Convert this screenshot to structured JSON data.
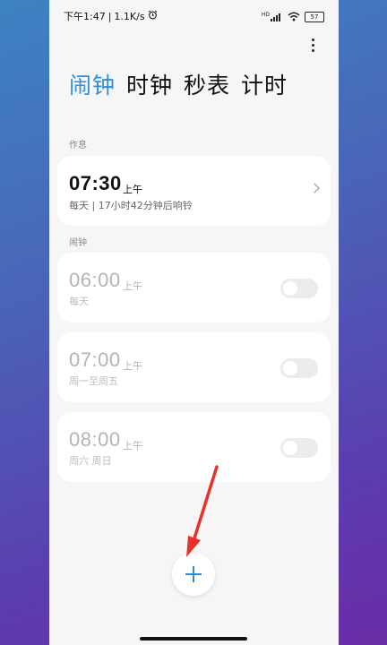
{
  "status_bar": {
    "time": "下午1:47",
    "separator": "|",
    "speed": "1.1K/s",
    "battery": "57",
    "signal_label": "HD"
  },
  "tabs": [
    {
      "label": "闹钟",
      "active": true
    },
    {
      "label": "时钟",
      "active": false
    },
    {
      "label": "秒表",
      "active": false
    },
    {
      "label": "计时",
      "active": false
    }
  ],
  "sleep_section": {
    "label": "作息",
    "card": {
      "time": "07:30",
      "ampm": "上午",
      "desc": "每天 | 17小时42分钟后响铃"
    }
  },
  "alarm_section": {
    "label": "闹钟",
    "alarms": [
      {
        "time": "06:00",
        "ampm": "上午",
        "repeat": "每天",
        "enabled": false
      },
      {
        "time": "07:00",
        "ampm": "上午",
        "repeat": "周一至周五",
        "enabled": false
      },
      {
        "time": "08:00",
        "ampm": "上午",
        "repeat": "周六 周日",
        "enabled": false
      }
    ]
  },
  "colors": {
    "accent": "#2e8fd8",
    "annotation_arrow": "#e8312a"
  },
  "icons": {
    "menu": "more-vertical-icon",
    "alarm_clock": "alarm-clock-icon",
    "wifi": "wifi-icon",
    "signal": "signal-icon",
    "battery": "battery-icon",
    "chevron": "chevron-right-icon",
    "add": "plus-icon"
  }
}
